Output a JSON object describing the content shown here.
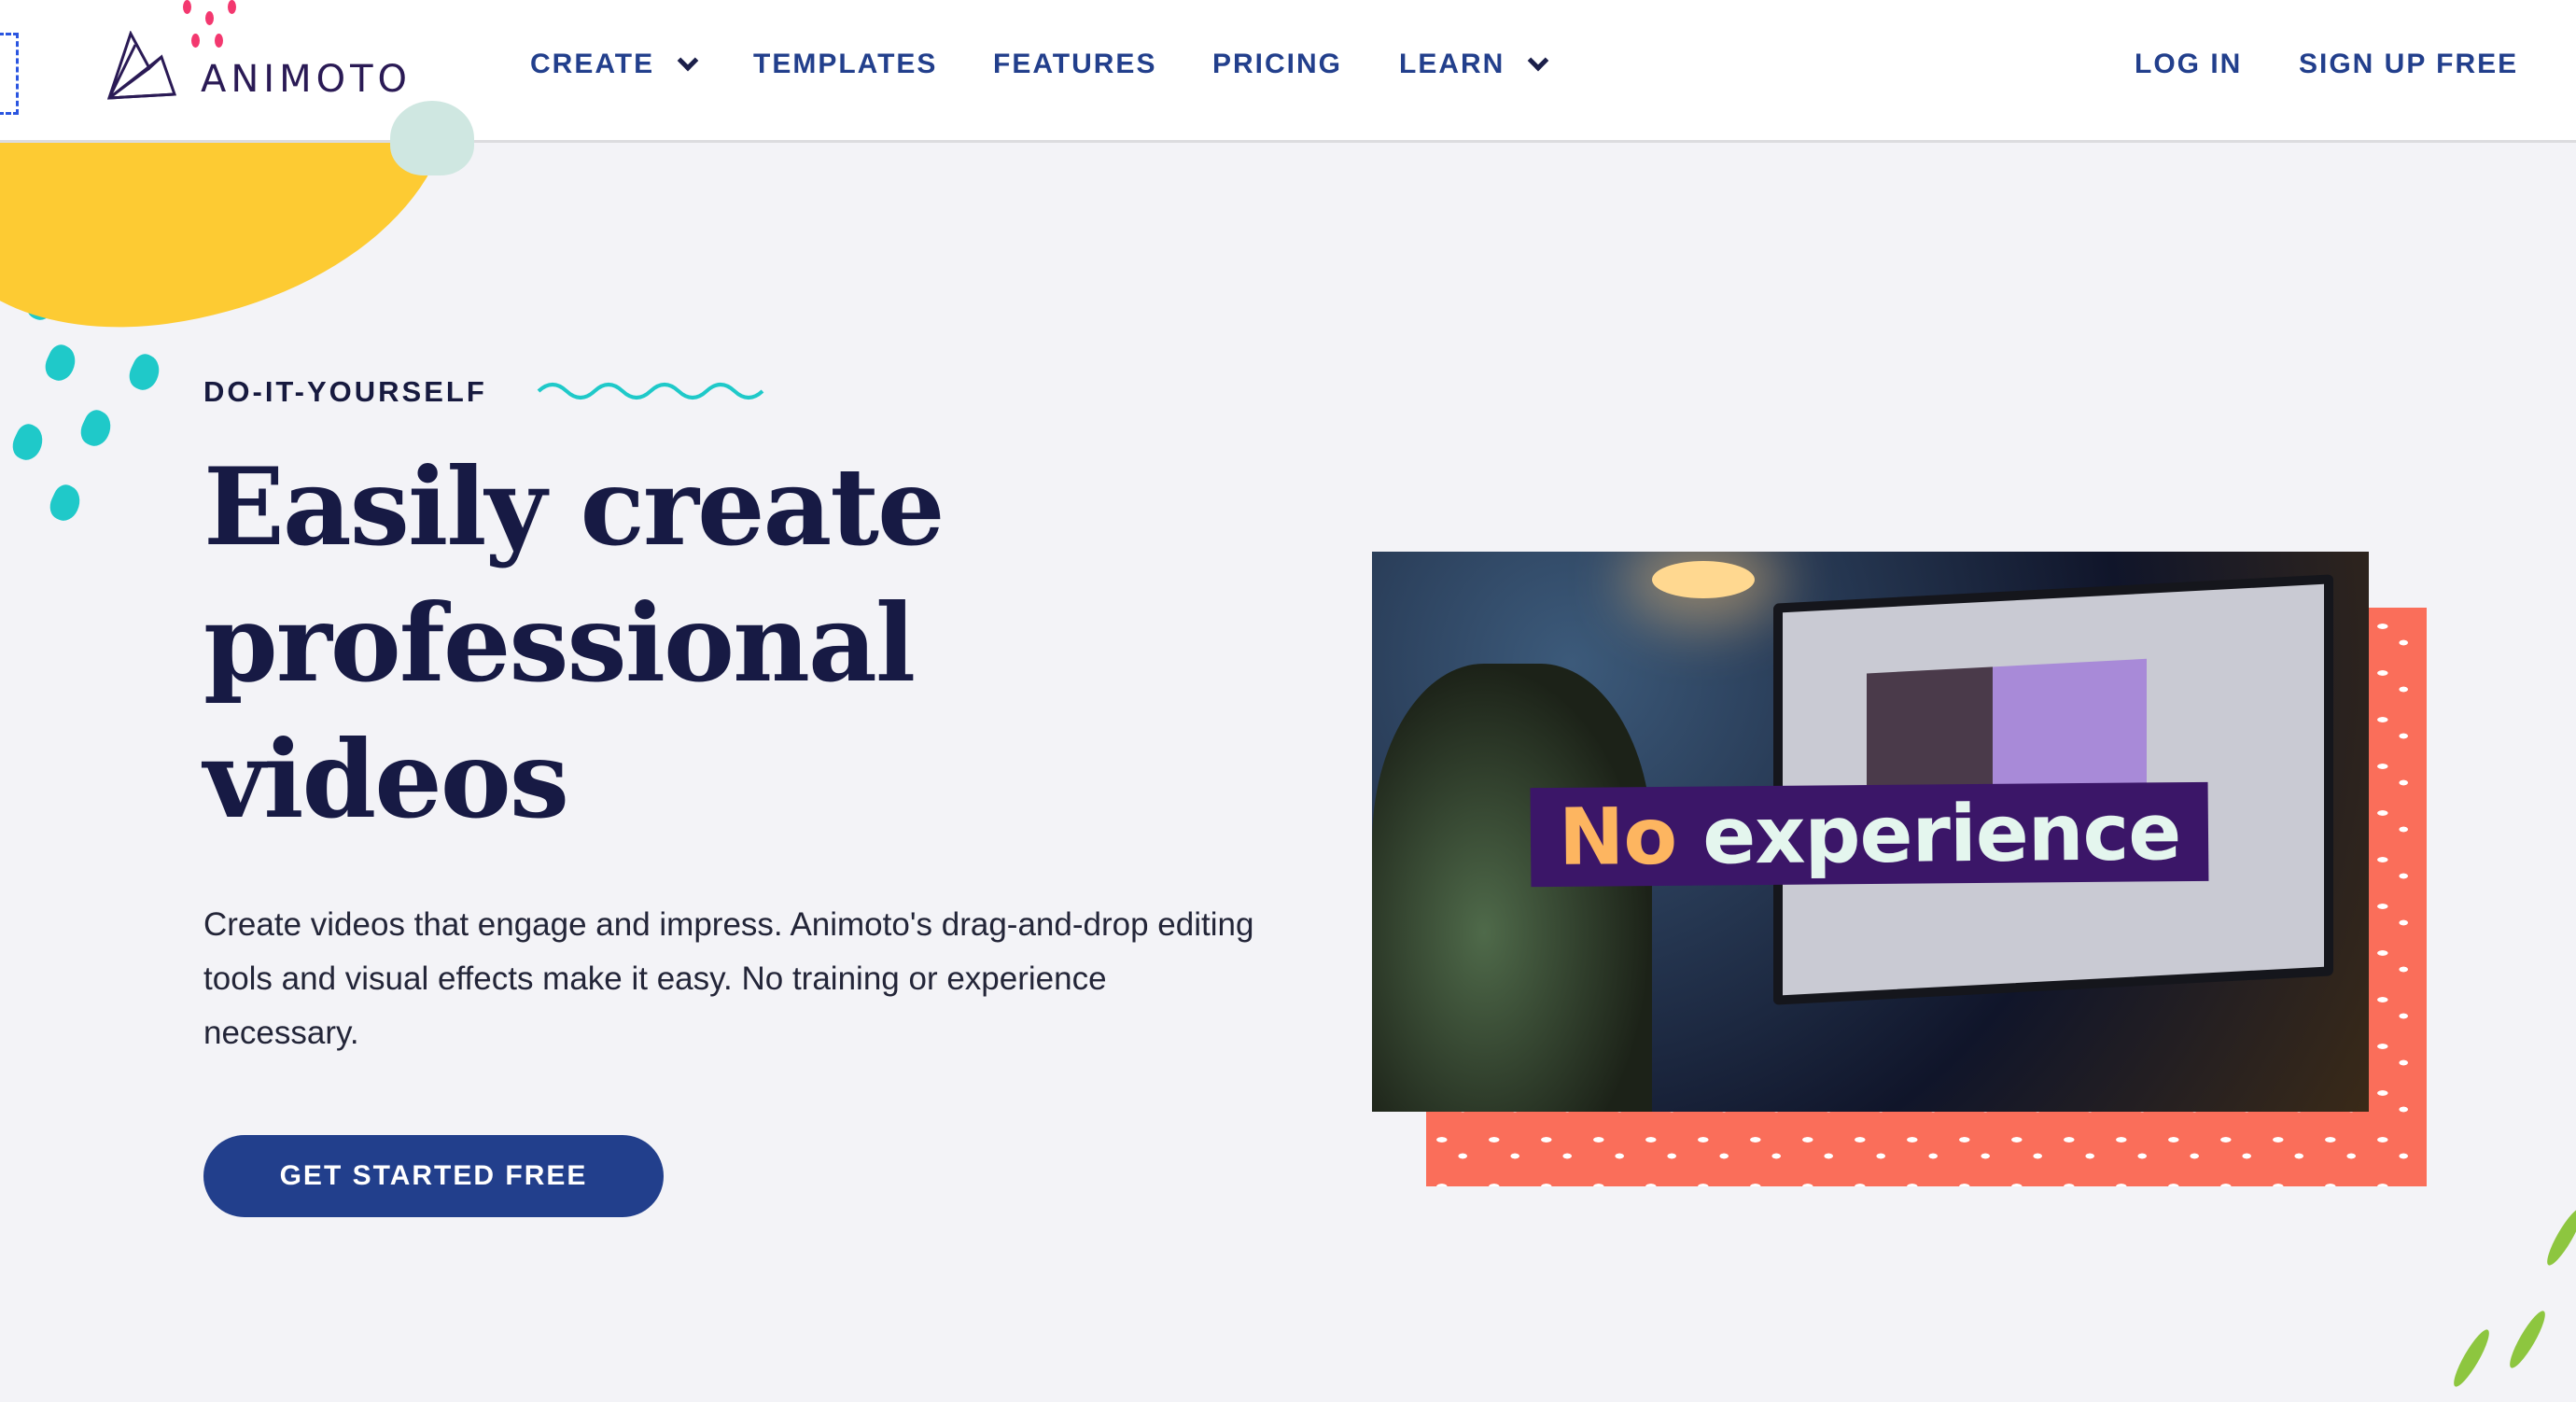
{
  "header": {
    "logo_text": "ANIMOTO",
    "nav": [
      {
        "label": "CREATE",
        "has_dropdown": true
      },
      {
        "label": "TEMPLATES",
        "has_dropdown": false
      },
      {
        "label": "FEATURES",
        "has_dropdown": false
      },
      {
        "label": "PRICING",
        "has_dropdown": false
      },
      {
        "label": "LEARN",
        "has_dropdown": true
      }
    ],
    "login": "LOG IN",
    "signup": "SIGN UP FREE"
  },
  "hero": {
    "eyebrow": "DO-IT-YOURSELF",
    "title": "Easily create professional videos",
    "description": "Create videos that engage and impress. Animoto's drag-and-drop editing tools and visual effects make it easy. No training or experience necessary.",
    "cta": "GET STARTED FREE",
    "video_caption_highlight": "No",
    "video_caption_rest": "experience"
  },
  "colors": {
    "brand": "#223f8c",
    "heading": "#171a44",
    "accent_yellow": "#fdcb33",
    "accent_teal": "#1fc9c9",
    "accent_coral": "#fa6e5a",
    "caption_bg": "#3b1668"
  }
}
